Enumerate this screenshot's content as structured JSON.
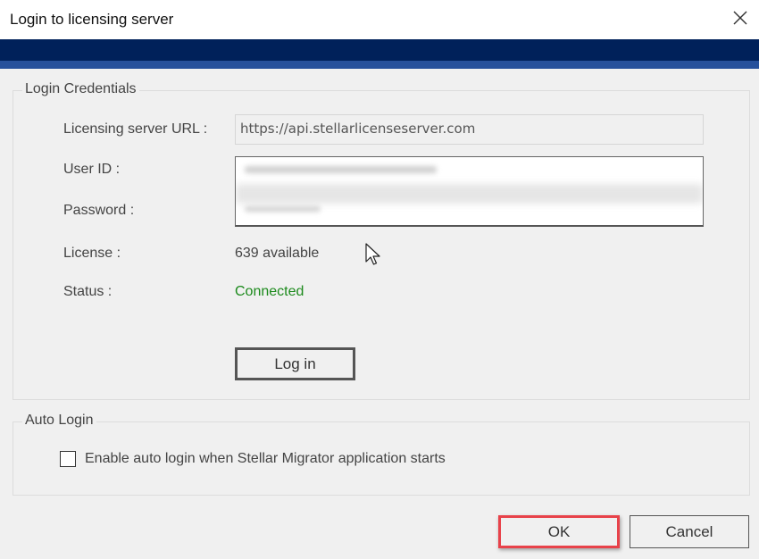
{
  "window": {
    "title": "Login to licensing server",
    "close_icon": "close-icon"
  },
  "colors": {
    "header_dark": "#00215a",
    "header_light": "#27519b",
    "status_connected": "#1c8a1c",
    "highlight": "#e8424a"
  },
  "login_credentials": {
    "legend": "Login Credentials",
    "url_label": "Licensing server URL :",
    "url_value": "https://api.stellarlicenseserver.com",
    "user_id_label": "User ID :",
    "user_id_value": "[redacted]",
    "password_label": "Password :",
    "password_value": "[redacted]",
    "license_label": "License :",
    "license_value": "639 available",
    "status_label": "Status :",
    "status_value": "Connected",
    "login_button": "Log in"
  },
  "auto_login": {
    "legend": "Auto Login",
    "checkbox_label": "Enable auto login when Stellar Migrator application starts",
    "checked": false
  },
  "footer": {
    "ok_button": "OK",
    "cancel_button": "Cancel"
  }
}
